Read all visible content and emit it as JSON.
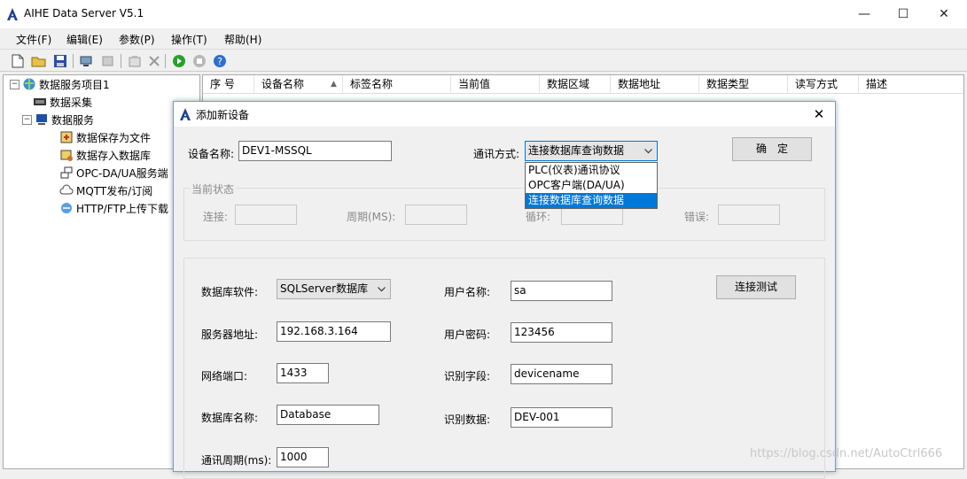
{
  "window": {
    "title": "AIHE Data Server V5.1",
    "minimize": "—",
    "maximize": "☐",
    "close": "✕"
  },
  "menu": [
    "文件(F)",
    "编辑(E)",
    "参数(P)",
    "操作(T)",
    "帮助(H)"
  ],
  "tree": {
    "root": "数据服务项目1",
    "collect": "数据采集",
    "service": "数据服务",
    "children": [
      "数据保存为文件",
      "数据存入数据库",
      "OPC-DA/UA服务端",
      "MQTT发布/订阅",
      "HTTP/FTP上传下载"
    ]
  },
  "list": {
    "columns": [
      "序 号",
      "设备名称",
      "标签名称",
      "当前值",
      "数据区域",
      "数据地址",
      "数据类型",
      "读写方式",
      "描述"
    ],
    "sort_indicator": "▲"
  },
  "dialog": {
    "title": "添加新设备",
    "close": "✕",
    "device_name_label": "设备名称:",
    "device_name_value": "DEV1-MSSQL",
    "comm_method_label": "通讯方式:",
    "comm_method_value": "连接数据库查询数据",
    "comm_options": [
      "PLC(仪表)通讯协议",
      "OPC客户端(DA/UA)",
      "连接数据库查询数据"
    ],
    "ok_button": "确　定",
    "status_group": {
      "title": "当前状态",
      "connect": "连接:",
      "period": "周期(MS):",
      "cycle": "循环:",
      "error": "错误:"
    },
    "db_software_label": "数据库软件:",
    "db_software_value": "SQLServer数据库",
    "server_addr_label": "服务器地址:",
    "server_addr_value": "192.168.3.164",
    "port_label": "网络端口:",
    "port_value": "1433",
    "db_name_label": "数据库名称:",
    "db_name_value": "Database",
    "comm_period_label": "通讯周期(ms):",
    "comm_period_value": "1000",
    "username_label": "用户名称:",
    "username_value": "sa",
    "password_label": "用户密码:",
    "password_value": "123456",
    "id_field_label": "识别字段:",
    "id_field_value": "devicename",
    "id_data_label": "识别数据:",
    "id_data_value": "DEV-001",
    "test_button": "连接测试"
  },
  "watermark": "https://blog.csdn.net/AutoCtrl666"
}
